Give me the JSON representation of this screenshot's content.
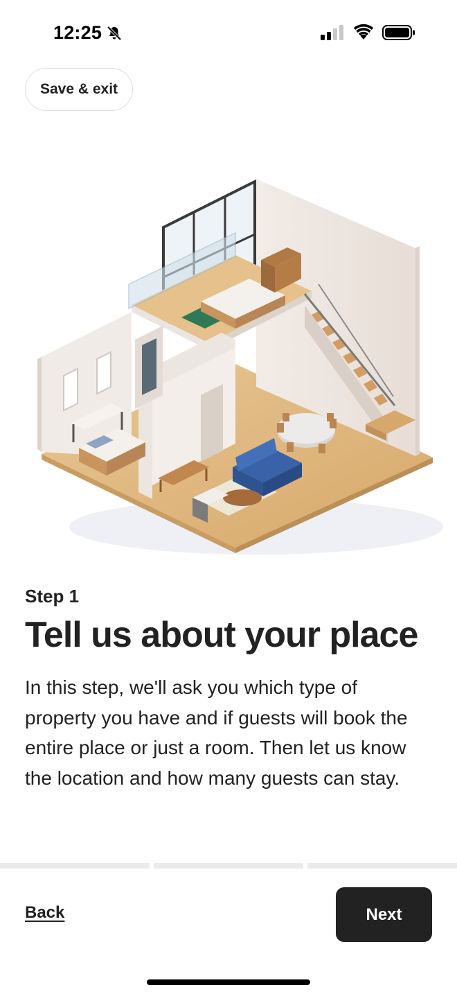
{
  "status_bar": {
    "time": "12:25",
    "icons": [
      "bell-slash-icon",
      "cellular-signal-icon",
      "wifi-icon",
      "battery-icon"
    ]
  },
  "header": {
    "save_exit_label": "Save & exit"
  },
  "illustration": {
    "icon": "isometric-loft-apartment-illustration"
  },
  "content": {
    "step_label": "Step 1",
    "title": "Tell us about your place",
    "description": "In this step, we'll ask you which type of property you have and if guests will book the entire place or just a room. Then let us know the location and how many guests can stay."
  },
  "progress": {
    "segments": 3,
    "current_fraction": 0
  },
  "footer": {
    "back_label": "Back",
    "next_label": "Next"
  },
  "colors": {
    "text": "#222222",
    "button_bg": "#222222",
    "progress_track": "#ebebeb"
  }
}
